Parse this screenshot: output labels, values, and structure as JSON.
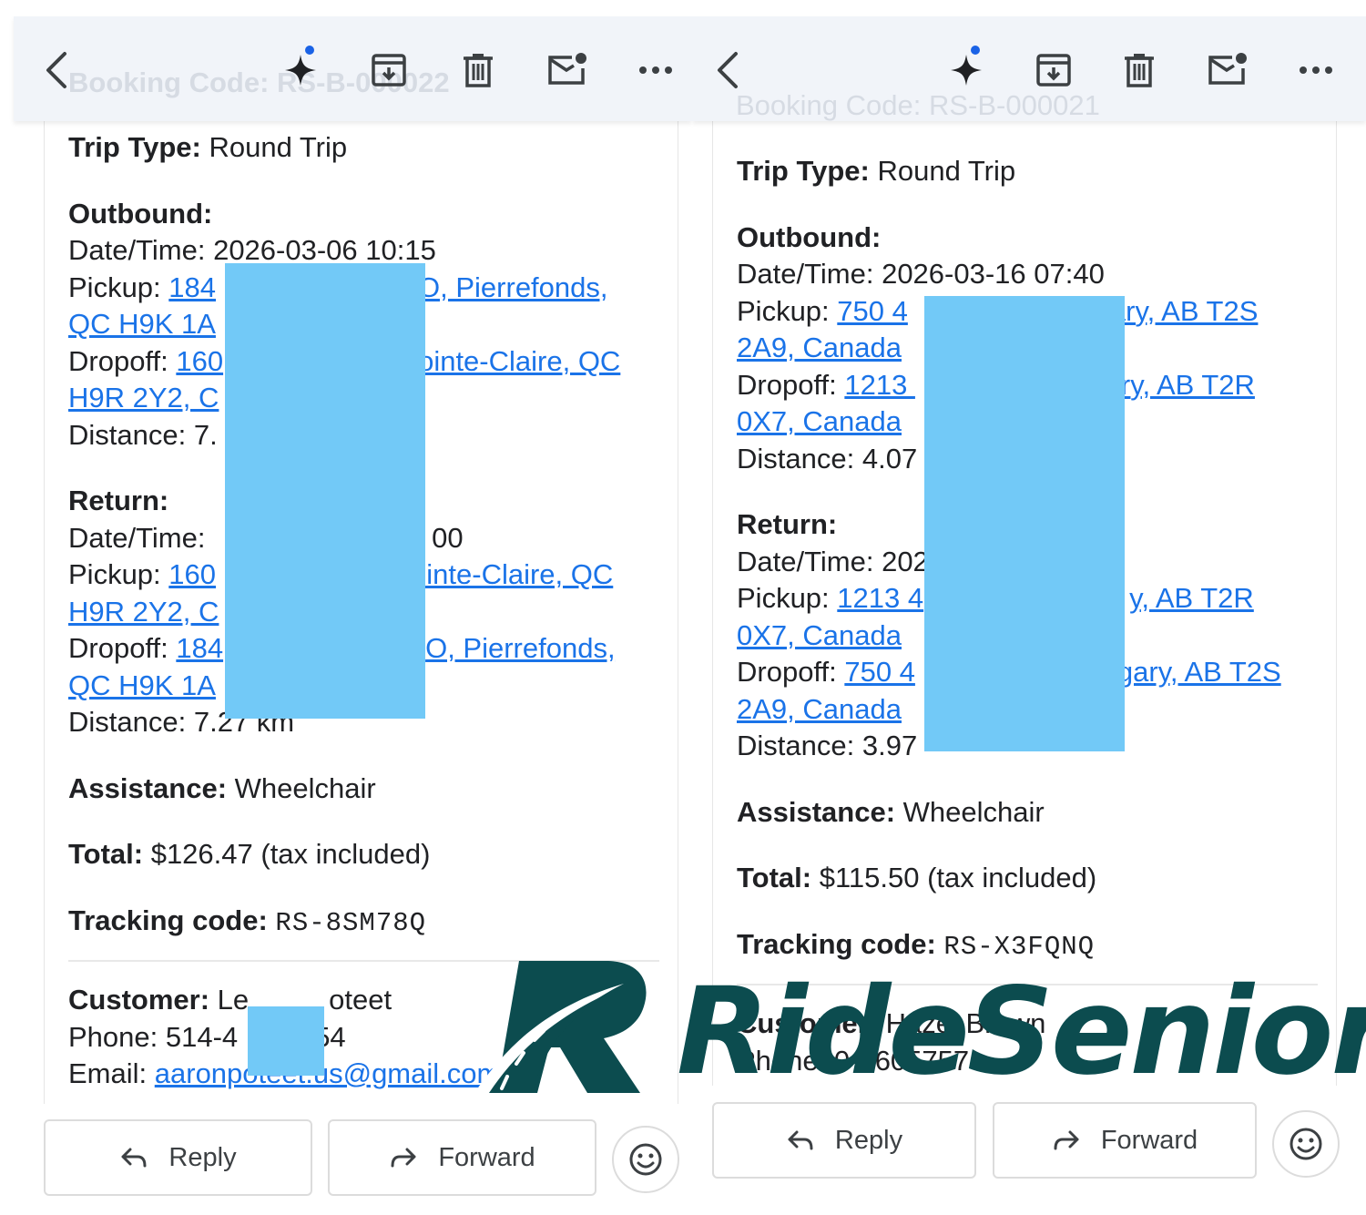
{
  "colors": {
    "link": "#1a73e8",
    "redaction": "#72c9f7",
    "brand": "#0c4c4f",
    "toolbar": "#f1f4f9"
  },
  "toolbar": {
    "icons": [
      "back-arrow-icon",
      "gemini-sparkle-icon",
      "archive-icon",
      "delete-icon",
      "mark-unread-icon",
      "more-icon"
    ]
  },
  "labels": {
    "trip_type": "Trip Type:",
    "outbound": "Outbound:",
    "return": "Return:",
    "datetime": "Date/Time:",
    "pickup": "Pickup:",
    "dropoff": "Dropoff:",
    "distance": "Distance:",
    "assistance": "Assistance:",
    "total": "Total:",
    "tracking": "Tracking code:",
    "customer": "Customer:",
    "phone": "Phone:",
    "email": "Email:"
  },
  "emails": [
    {
      "ghost_header": "Booking Code: RS-B-000022",
      "trip_type": "Round Trip",
      "outbound": {
        "datetime": "2026-03-06 10:15",
        "pickup_l1a": "184",
        "pickup_l1b": "O, Pierrefonds,",
        "pickup_l2": "QC H9K 1A",
        "dropoff_l1a": "160",
        "dropoff_l1b": "ointe-Claire, QC",
        "dropoff_l2": "H9R 2Y2, C",
        "distance": "7."
      },
      "return": {
        "datetime_a": "",
        "datetime_b": "00",
        "pickup_l1a": "160",
        "pickup_l1b": "ointe-Claire, QC",
        "pickup_l2": "H9R 2Y2, C",
        "dropoff_l1a": "184",
        "dropoff_l1b": "O, Pierrefonds,",
        "dropoff_l2": "QC H9K 1A",
        "distance": "7.27 km"
      },
      "assistance": "Wheelchair",
      "total": "$126.47 (tax included)",
      "tracking": "RS-8SM78Q",
      "customer_a": "Le",
      "customer_b": "oteet",
      "phone_a": "514-4",
      "phone_b": "54",
      "email": "aaronpoteet.us@gmail.com",
      "reply_label": "Reply",
      "forward_label": "Forward"
    },
    {
      "ghost_header": "Booking Code: RS-B-000021",
      "trip_type": "Round Trip",
      "outbound": {
        "datetime": "2026-03-16 07:40",
        "pickup_l1a": "750 4",
        "pickup_l1b": "ary, AB T2S",
        "pickup_l2": "2A9, Canada",
        "dropoff_l1a": "1213 ",
        "dropoff_l1b": "ry, AB T2R",
        "dropoff_l2": "0X7, Canada",
        "distance": "4.07"
      },
      "return": {
        "datetime_a": "202",
        "datetime_b": "",
        "pickup_l1a": "1213 4",
        "pickup_l1b": "y, AB T2R",
        "pickup_l2": "0X7, Canada",
        "dropoff_l1a": "750 4",
        "dropoff_l1b": "gary, AB T2S",
        "dropoff_l2": "2A9, Canada",
        "distance": "3.97"
      },
      "assistance": "Wheelchair",
      "total": "$115.50 (tax included)",
      "tracking": "RS-X3FQNQ",
      "customer_a": "",
      "customer_b": "Hazel Brown",
      "phone_a": "",
      "phone_b": "0-3605757",
      "reply_label": "Reply",
      "forward_label": "Forward"
    }
  ],
  "brand": {
    "logo_text": "RideSenior",
    "logo_icon": "road-r-logo-icon"
  }
}
